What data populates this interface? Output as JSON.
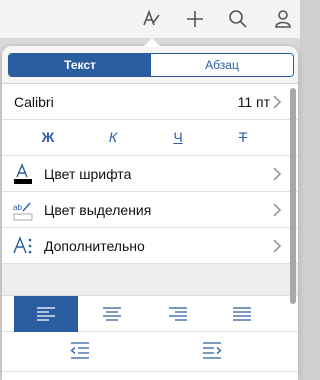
{
  "topbar": {
    "icons": [
      "format-brush-icon",
      "add-icon",
      "search-icon",
      "profile-icon"
    ]
  },
  "tabs": {
    "text_label": "Текст",
    "paragraph_label": "Абзац",
    "active": "text"
  },
  "font": {
    "name": "Calibri",
    "size": "11 пт"
  },
  "styles": {
    "bold": "Ж",
    "italic": "К",
    "underline": "Ч",
    "strikethrough": "Т"
  },
  "menu": {
    "font_color": "Цвет шрифта",
    "highlight_color": "Цвет выделения",
    "more": "Дополнительно"
  },
  "paragraph": {
    "alignment_selected": "left",
    "alignments": [
      "left",
      "center",
      "right",
      "justify"
    ],
    "indent_buttons": [
      "decrease-indent",
      "increase-indent"
    ]
  },
  "colors": {
    "accent": "#2b5ea1",
    "font_color_swatch": "#000000",
    "highlight_swatch": "#ffffff"
  }
}
